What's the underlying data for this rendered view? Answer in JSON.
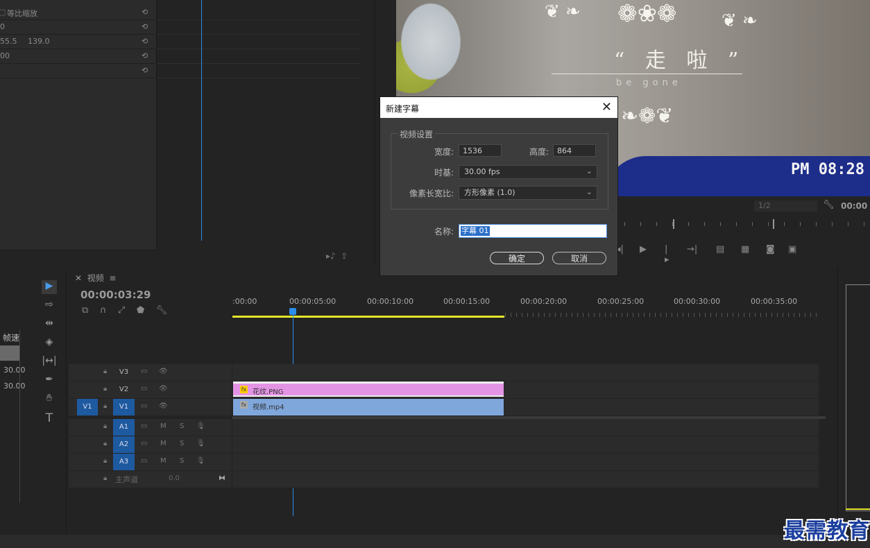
{
  "effect_controls": {
    "rows": [
      {
        "label": "等比缩放",
        "value": ""
      },
      {
        "label": "0",
        "value": ""
      },
      {
        "label": "55.5",
        "value": "139.0"
      },
      {
        "label": "00",
        "value": ""
      },
      {
        "label": "",
        "value": ""
      }
    ],
    "reset_glyph": "⟲"
  },
  "program_monitor": {
    "overlay_title": "“ 走 啦 ”",
    "overlay_subtitle": "be gone",
    "camera_timestamp": "PM 08:28",
    "quality": "1/2",
    "timecode": "00:00"
  },
  "timeline": {
    "tab_label": "视频",
    "timecode": "00:00:03:29",
    "ruler_labels": [
      ":00:00",
      "00:00:05:00",
      "00:00:10:00",
      "00:00:15:00",
      "00:00:20:00",
      "00:00:25:00",
      "00:00:30:00",
      "00:00:35:00"
    ],
    "video_tracks": [
      {
        "name": "V3",
        "source": ""
      },
      {
        "name": "V2",
        "source": ""
      },
      {
        "name": "V1",
        "source": "V1"
      }
    ],
    "audio_tracks": [
      {
        "name": "A1"
      },
      {
        "name": "A2"
      },
      {
        "name": "A3"
      }
    ],
    "master": {
      "label": "主声道",
      "value": "0.0"
    },
    "clips": [
      {
        "track": "V2",
        "name": "花纹.PNG",
        "color": "#e494e4"
      },
      {
        "track": "V1",
        "name": "视频.mp4",
        "color": "#7fa7dc"
      }
    ],
    "left_strip": {
      "header": "帧速",
      "values": [
        "30.00",
        "30.00"
      ]
    }
  },
  "dialog": {
    "title": "新建字幕",
    "group_label": "视频设置",
    "width_label": "宽度:",
    "width_value": "1536",
    "height_label": "高度:",
    "height_value": "864",
    "timebase_label": "时基:",
    "timebase_value": "30.00 fps",
    "pixel_aspect_label": "像素长宽比:",
    "pixel_aspect_value": "方形像素 (1.0)",
    "name_label": "名称:",
    "name_value": "字幕 01",
    "ok_label": "确定",
    "cancel_label": "取消",
    "close_glyph": "✕"
  },
  "watermark": "最需教育"
}
